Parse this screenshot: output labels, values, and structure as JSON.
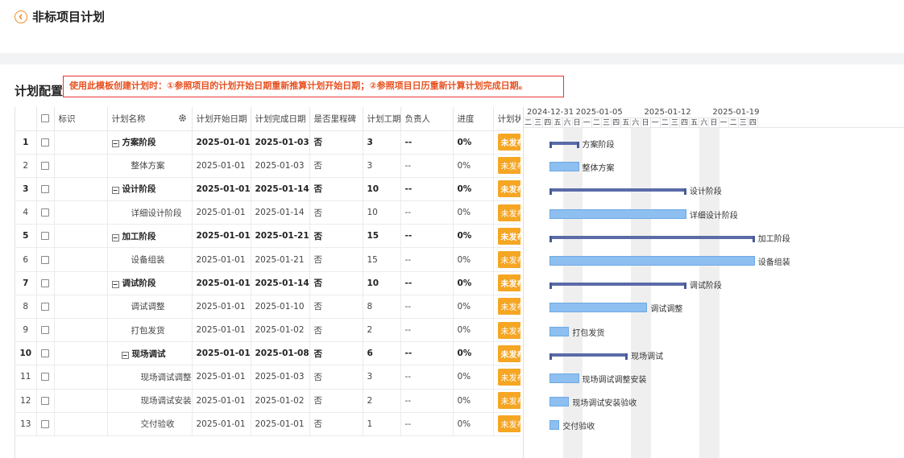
{
  "header": {
    "title": "非标项目计划"
  },
  "section": {
    "title": "计划配置",
    "notice": "使用此模板创建计划时：①参照项目的计划开始日期重新推算计划开始日期；②参照项目日历重新计算计划完成日期。"
  },
  "grid": {
    "columns": [
      "标识",
      "计划名称",
      "计划开始日期",
      "计划完成日期",
      "是否里程碑",
      "计划工期",
      "负责人",
      "进度",
      "计划状"
    ],
    "rows": [
      {
        "no": "1",
        "name": "方案阶段",
        "level": 0,
        "group": true,
        "start": "2025-01-01",
        "end": "2025-01-03",
        "milestone": "否",
        "duration": "3",
        "owner": "--",
        "progress": "0%",
        "status": "未发布"
      },
      {
        "no": "2",
        "name": "整体方案",
        "level": 1,
        "group": false,
        "start": "2025-01-01",
        "end": "2025-01-03",
        "milestone": "否",
        "duration": "3",
        "owner": "--",
        "progress": "0%",
        "status": "未发布"
      },
      {
        "no": "3",
        "name": "设计阶段",
        "level": 0,
        "group": true,
        "start": "2025-01-01",
        "end": "2025-01-14",
        "milestone": "否",
        "duration": "10",
        "owner": "--",
        "progress": "0%",
        "status": "未发布"
      },
      {
        "no": "4",
        "name": "详细设计阶段",
        "level": 1,
        "group": false,
        "start": "2025-01-01",
        "end": "2025-01-14",
        "milestone": "否",
        "duration": "10",
        "owner": "--",
        "progress": "0%",
        "status": "未发布"
      },
      {
        "no": "5",
        "name": "加工阶段",
        "level": 0,
        "group": true,
        "start": "2025-01-01",
        "end": "2025-01-21",
        "milestone": "否",
        "duration": "15",
        "owner": "--",
        "progress": "0%",
        "status": "未发布"
      },
      {
        "no": "6",
        "name": "设备组装",
        "level": 1,
        "group": false,
        "start": "2025-01-01",
        "end": "2025-01-21",
        "milestone": "否",
        "duration": "15",
        "owner": "--",
        "progress": "0%",
        "status": "未发布"
      },
      {
        "no": "7",
        "name": "调试阶段",
        "level": 0,
        "group": true,
        "start": "2025-01-01",
        "end": "2025-01-14",
        "milestone": "否",
        "duration": "10",
        "owner": "--",
        "progress": "0%",
        "status": "未发布"
      },
      {
        "no": "8",
        "name": "调试调整",
        "level": 1,
        "group": false,
        "start": "2025-01-01",
        "end": "2025-01-10",
        "milestone": "否",
        "duration": "8",
        "owner": "--",
        "progress": "0%",
        "status": "未发布"
      },
      {
        "no": "9",
        "name": "打包发货",
        "level": 1,
        "group": false,
        "start": "2025-01-01",
        "end": "2025-01-02",
        "milestone": "否",
        "duration": "2",
        "owner": "--",
        "progress": "0%",
        "status": "未发布"
      },
      {
        "no": "10",
        "name": "现场调试",
        "level": 1,
        "group": true,
        "start": "2025-01-01",
        "end": "2025-01-08",
        "milestone": "否",
        "duration": "6",
        "owner": "--",
        "progress": "0%",
        "status": "未发布"
      },
      {
        "no": "11",
        "name": "现场调试调整安装",
        "level": 2,
        "group": false,
        "start": "2025-01-01",
        "end": "2025-01-03",
        "milestone": "否",
        "duration": "3",
        "owner": "--",
        "progress": "0%",
        "status": "未发布"
      },
      {
        "no": "12",
        "name": "现场调试安装验收",
        "level": 2,
        "group": false,
        "start": "2025-01-01",
        "end": "2025-01-02",
        "milestone": "否",
        "duration": "2",
        "owner": "--",
        "progress": "0%",
        "status": "未发布"
      },
      {
        "no": "13",
        "name": "交付验收",
        "level": 2,
        "group": false,
        "start": "2025-01-01",
        "end": "2025-01-01",
        "milestone": "否",
        "duration": "1",
        "owner": "--",
        "progress": "0%",
        "status": "未发布"
      }
    ]
  },
  "gantt": {
    "weeks": [
      "2024-12-31",
      "2025-01-05",
      "2025-01-12",
      "2025-01-19"
    ],
    "day_letters": [
      "二",
      "三",
      "四",
      "五",
      "六",
      "日",
      "一",
      "二",
      "三",
      "四",
      "五",
      "六",
      "日",
      "一",
      "二",
      "三",
      "四",
      "五",
      "六",
      "日",
      "一",
      "二",
      "三",
      "四"
    ],
    "weekend_days": [
      "六",
      "日"
    ]
  },
  "icons": {
    "back": "back-circle-icon",
    "settings": "gear-icon"
  },
  "colors": {
    "accent": "#f28b22",
    "status": "#f5a623",
    "summary_bar": "#5a6ba8",
    "task_bar": "#8dbff0",
    "notice": "#e8501f"
  }
}
